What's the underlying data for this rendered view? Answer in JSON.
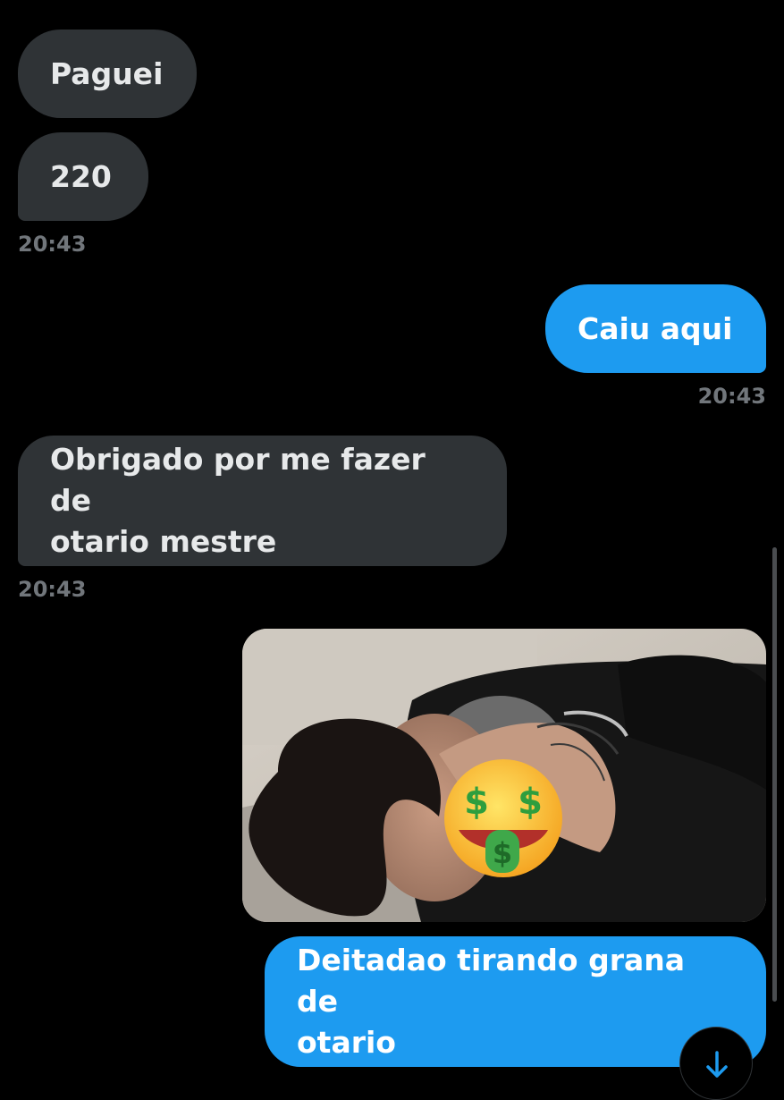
{
  "messages": [
    {
      "side": "incoming",
      "text": "Paguei"
    },
    {
      "side": "incoming",
      "text": "220",
      "timestamp": "20:43"
    },
    {
      "side": "outgoing",
      "text": "Caiu aqui",
      "timestamp": "20:43"
    },
    {
      "side": "incoming",
      "text_line1": "Obrigado por me fazer de",
      "text_line2": "otario mestre",
      "timestamp": "20:43"
    },
    {
      "side": "outgoing",
      "media": "photo",
      "sticker": "money-mouth-face-emoji"
    },
    {
      "side": "outgoing",
      "text_line1": "Deitadao tirando grana de",
      "text_line2": "otario"
    }
  ],
  "controls": {
    "scroll_down_icon": "arrow-down-icon"
  },
  "colors": {
    "background": "#000000",
    "incoming_bubble": "#2f3336",
    "outgoing_bubble": "#1d9bf0",
    "timestamp": "#71767b",
    "incoming_text": "#e7e9ea",
    "outgoing_text": "#ffffff"
  }
}
